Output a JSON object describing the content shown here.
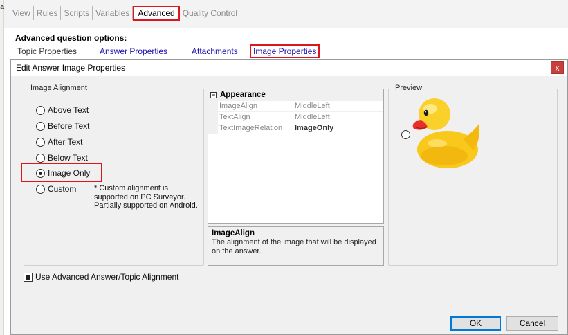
{
  "app": {
    "tabs": [
      "View",
      "Rules",
      "Scripts",
      "Variables",
      "Advanced",
      "Quality Control"
    ],
    "active_tab": "Advanced",
    "advanced_title": "Advanced question options:",
    "subtabs": {
      "topic": "Topic Properties",
      "answer": "Answer Properties",
      "attachments": "Attachments",
      "image": "Image Properties"
    }
  },
  "dialog": {
    "title": "Edit Answer Image Properties",
    "close_glyph": "x",
    "alignment": {
      "legend": "Image Alignment",
      "options": [
        "Above Text",
        "Before Text",
        "After Text",
        "Below Text",
        "Image Only",
        "Custom"
      ],
      "selected": "Image Only",
      "custom_note": "* Custom alignment is supported on PC Surveyor. Partially supported on Android."
    },
    "properties": {
      "category": "Appearance",
      "expander": "−",
      "rows": [
        {
          "name": "ImageAlign",
          "value": "MiddleLeft"
        },
        {
          "name": "TextAlign",
          "value": "MiddleLeft"
        },
        {
          "name": "TextImageRelation",
          "value": "ImageOnly"
        }
      ]
    },
    "help": {
      "title": "ImageAlign",
      "description": "The alignment of the image that will be displayed on the answer."
    },
    "preview": {
      "legend": "Preview"
    },
    "checkbox": {
      "label": "Use Advanced Answer/Topic Alignment",
      "checked": true
    },
    "buttons": {
      "ok": "OK",
      "cancel": "Cancel"
    }
  },
  "colors": {
    "highlight": "#e0141b",
    "link": "#1a0dab",
    "focus": "#0078d7",
    "duck_yellow": "#f8c91a",
    "duck_beak": "#e8302a"
  }
}
